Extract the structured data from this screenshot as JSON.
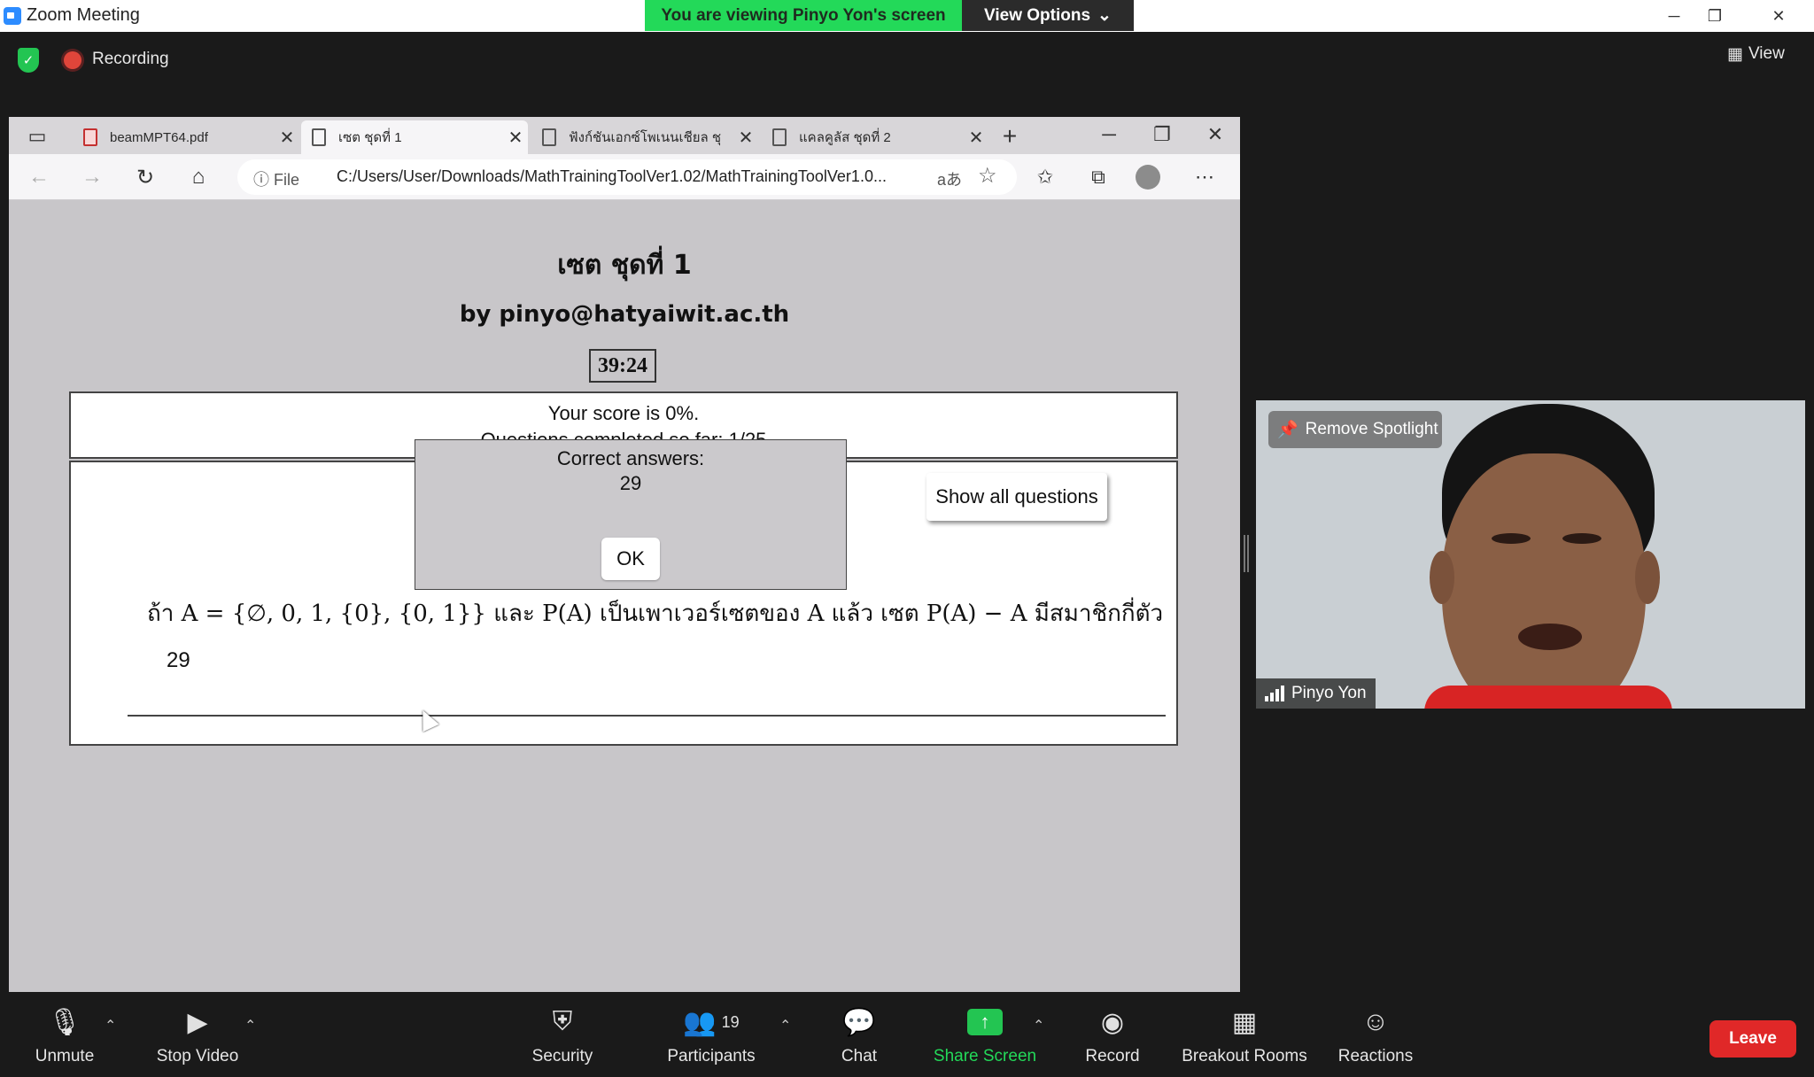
{
  "window": {
    "title": "Zoom Meeting",
    "viewing_banner": "You are viewing Pinyo Yon's screen",
    "view_options": "View Options",
    "minimize": "─",
    "restore": "❐",
    "close": "✕"
  },
  "topbar": {
    "recording_label": "Recording",
    "view_label": "View"
  },
  "browser": {
    "tabs": [
      {
        "label": "beamMPT64.pdf",
        "close": "✕"
      },
      {
        "label": "เซต ชุดที่ 1",
        "close": "✕"
      },
      {
        "label": "ฟังก์ชันเอกซ์โพเนนเชียล ชุ",
        "close": "✕"
      },
      {
        "label": "แคลคูลัส ชุดที่ 2",
        "close": "✕"
      }
    ],
    "new_tab": "+",
    "address": {
      "info_label": "ⓘ  File",
      "url": "C:/Users/User/Downloads/MathTrainingToolVer1.02/MathTrainingToolVer1.0...",
      "read_aloud": "aあ"
    }
  },
  "page": {
    "heading": "เซต ชุดที่ 1",
    "author": "by pinyo@hatyaiwit.ac.th",
    "timer": "39:24",
    "score": "Your score is 0%.",
    "progress": "Questions completed so far: 1/25",
    "show_all_questions": "Show all questions",
    "question": "ถ้า A = {∅, 0, 1, {0}, {0, 1}} และ P(A) เป็นเพาเวอร์เซตของ A แล้ว เซต P(A) − A มีสมาชิกกี่ตัว",
    "user_answer": "29"
  },
  "modal": {
    "title": "Correct answers:",
    "value": "29",
    "ok": "OK"
  },
  "video": {
    "remove_spotlight": "Remove Spotlight",
    "participant_name": "Pinyo Yon"
  },
  "toolbar": {
    "unmute": "Unmute",
    "stop_video": "Stop Video",
    "security": "Security",
    "participants": "Participants",
    "participants_count": "19",
    "chat": "Chat",
    "share_screen": "Share Screen",
    "record": "Record",
    "breakout_rooms": "Breakout Rooms",
    "reactions": "Reactions",
    "leave": "Leave"
  },
  "colors": {
    "banner_green": "#23d959",
    "share_green": "#23c552",
    "leave_red": "#e02828",
    "recording_red": "#e0453a"
  }
}
